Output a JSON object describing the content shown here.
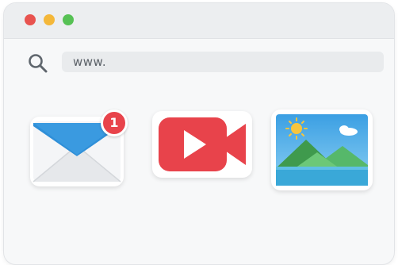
{
  "window": {
    "controls": {
      "close_color": "#e8534f",
      "minimize_color": "#f4b739",
      "maximize_color": "#56c154"
    }
  },
  "toolbar": {
    "search_icon": "search-icon",
    "address": "www."
  },
  "apps": {
    "mail": {
      "icon": "envelope-icon",
      "badge_count": "1"
    },
    "video": {
      "icon": "video-camera-icon"
    },
    "photos": {
      "icon": "landscape-photo-icon"
    }
  },
  "colors": {
    "mail_blue": "#2f8fd8",
    "video_red": "#e8434b",
    "photo_sky": "#43a6e6",
    "photo_hill": "#4fb35c",
    "photo_sun": "#f6c53d"
  }
}
